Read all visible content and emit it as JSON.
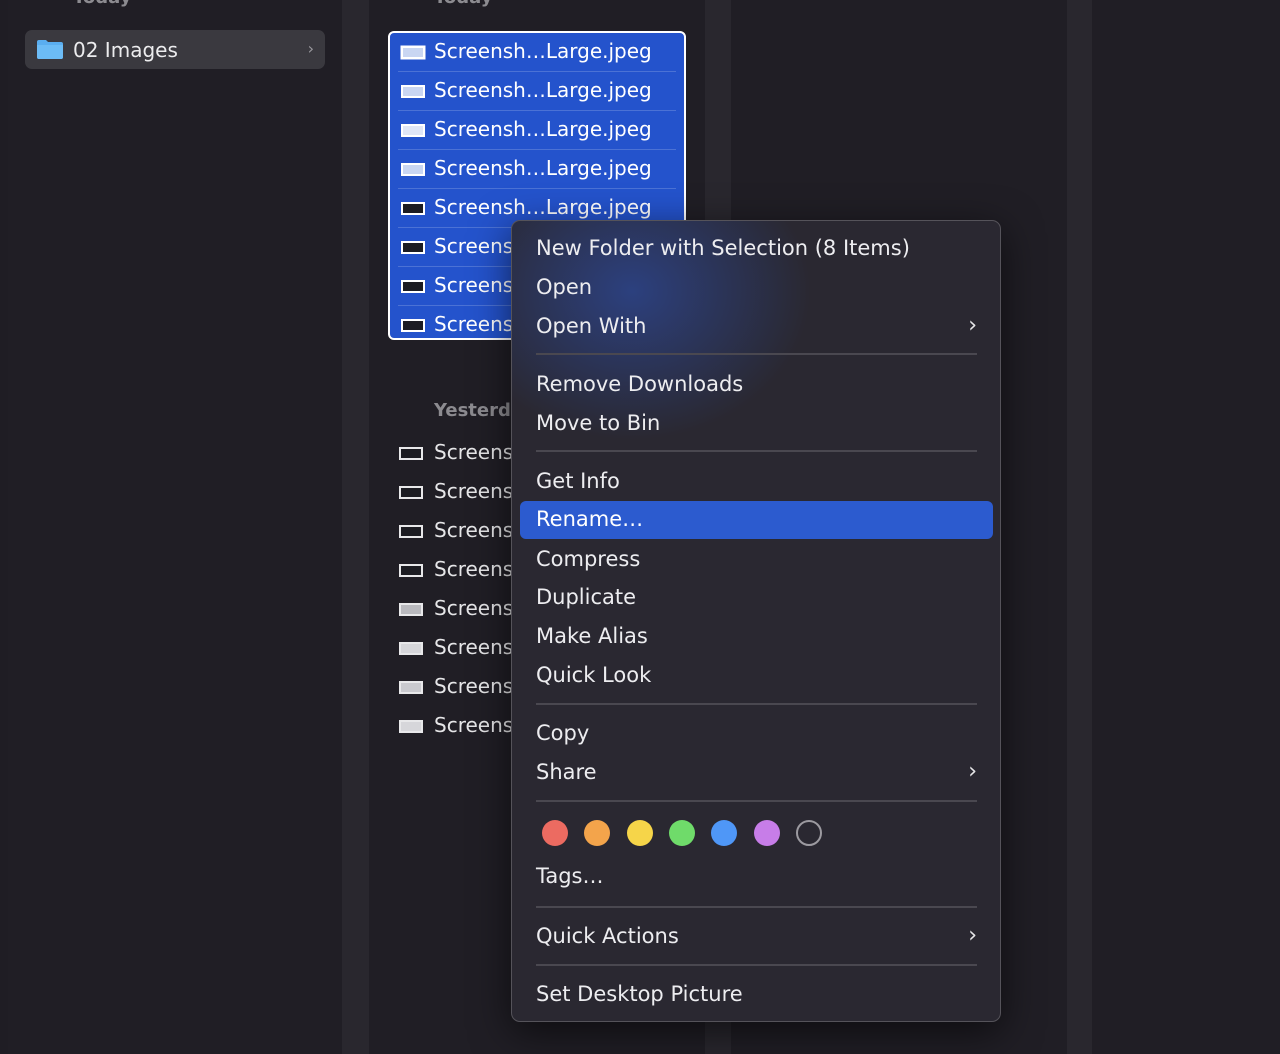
{
  "column1": {
    "heading": "Today",
    "folder": {
      "name": "02 Images",
      "icon": "folder-icon"
    }
  },
  "column2": {
    "heading": "Today",
    "selected_files": [
      "Screensh…Large.jpeg",
      "Screensh…Large.jpeg",
      "Screensh…Large.jpeg",
      "Screensh…Large.jpeg",
      "Screensh…Large.jpeg",
      "Screens",
      "Screens",
      "Screens"
    ],
    "section_label": "Yesterd",
    "yesterday_files": [
      "Screens",
      "Screens",
      "Screens",
      "Screens",
      "Screens",
      "Screens",
      "Screens",
      "Screens"
    ]
  },
  "context_menu": {
    "new_folder": "New Folder with Selection (8 Items)",
    "open": "Open",
    "open_with": "Open With",
    "remove_downloads": "Remove Downloads",
    "move_to_bin": "Move to Bin",
    "get_info": "Get Info",
    "rename": "Rename…",
    "compress": "Compress",
    "duplicate": "Duplicate",
    "make_alias": "Make Alias",
    "quick_look": "Quick Look",
    "copy": "Copy",
    "share": "Share",
    "tags_label": "Tags…",
    "quick_actions": "Quick Actions",
    "set_desktop_picture": "Set Desktop Picture",
    "submenu_glyph": "›",
    "tag_colors": {
      "red": "#ec6b61",
      "orange": "#f3a44b",
      "yellow": "#f6d549",
      "green": "#6fdb6a",
      "blue": "#4f97f7",
      "purple": "#c77de8",
      "none": "none"
    }
  },
  "colors": {
    "selection": "#2453cc",
    "highlight": "#2c5bcf",
    "background": "#1f1d24",
    "menu_background": "#2a2831"
  }
}
